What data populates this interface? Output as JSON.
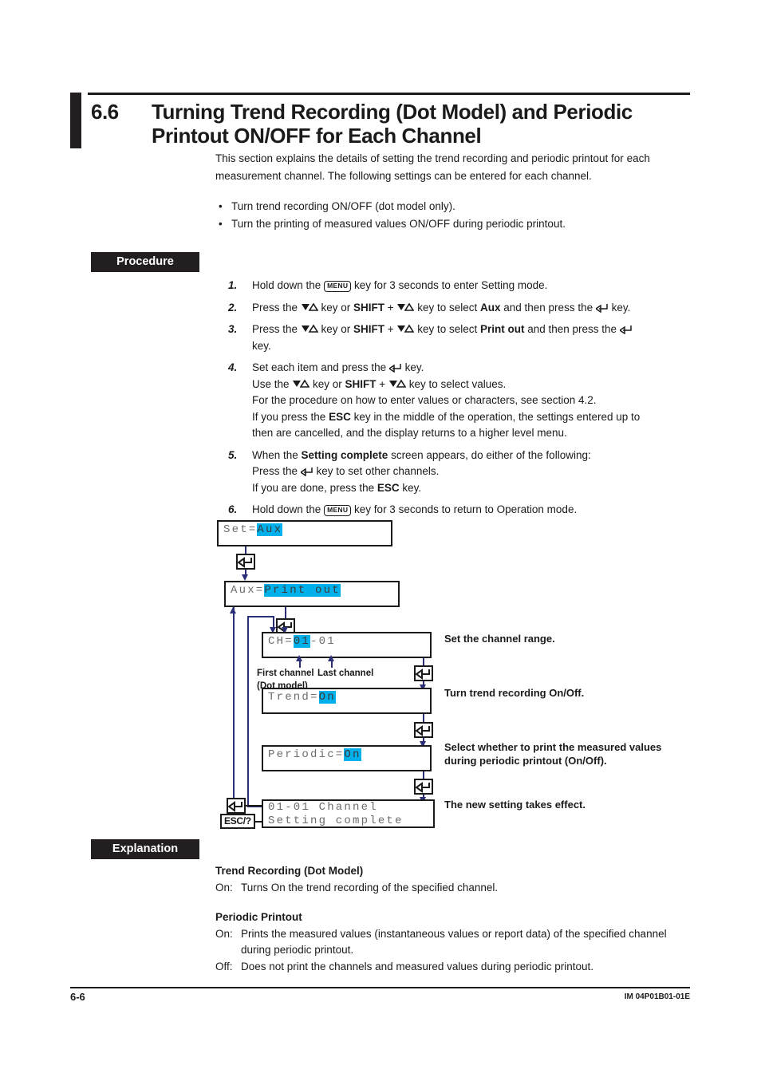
{
  "section": {
    "number": "6.6",
    "title": "Turning Trend Recording (Dot Model) and Periodic Printout ON/OFF for Each Channel",
    "intro_line1": "This section explains the details of setting the trend recording and periodic printout for",
    "intro_line2": "each measurement channel.",
    "intro_line3": "The following settings can be entered for each channel.",
    "bullet1": "Turn trend recording ON/OFF (dot model only).",
    "bullet2": "Turn the printing of measured values ON/OFF during periodic printout."
  },
  "labels": {
    "procedure": "Procedure",
    "explanation": "Explanation"
  },
  "steps": [
    {
      "num": "1.",
      "lines": [
        "Hold down the [MENU] key for 3 seconds to enter Setting mode."
      ]
    },
    {
      "num": "2.",
      "lines": [
        "Press the ▽△ key or SHIFT + ▽△ key to select Aux and then press the ↵ key."
      ]
    },
    {
      "num": "3.",
      "lines": [
        "Press the ▽△ key or SHIFT + ▽△ key to select Print out and then press the ↵",
        "key."
      ]
    },
    {
      "num": "4.",
      "lines": [
        "Set each item and press the ↵ key.",
        "Use the ▽△ key or SHIFT + ▽△ key to select values.",
        "For the procedure on how to enter values or characters, see section 4.2.",
        "If you press the ESC key in the middle of the operation, the settings entered up to",
        "then are cancelled, and the display returns to a higher level menu."
      ]
    },
    {
      "num": "5.",
      "lines": [
        "When the Setting complete screen appears, do either of the following:",
        "Press the ↵ key to set other channels.",
        "If you are done, press the ESC key."
      ]
    },
    {
      "num": "6.",
      "lines": [
        "Hold down the [MENU] key for 3 seconds to return to Operation mode."
      ]
    }
  ],
  "step_text": {
    "s1_a": "Hold down the ",
    "s1_menu": "MENU",
    "s1_b": " key for 3 seconds to enter Setting mode.",
    "s2_a": "Press the ",
    "s2_b": " key or ",
    "s2_shift": "SHIFT",
    "s2_c": " + ",
    "s2_d": " key to select ",
    "s2_aux": "Aux",
    "s2_e": " and then press the ",
    "s2_f": " key.",
    "s3_d": " key to select ",
    "s3_printout": "Print out",
    "s3_e": " and then press the ",
    "s3_f": "key.",
    "s4_l1a": "Set each item and press the ",
    "s4_l1b": " key.",
    "s4_l2a": "Use the ",
    "s4_l2b": " key or ",
    "s4_l2c": " key to select values.",
    "s4_l3": "For the procedure on how to enter values or characters, see section 4.2.",
    "s4_l4a": "If you press the ",
    "s4_esc": "ESC",
    "s4_l4b": " key in the middle of the operation, the settings entered up to",
    "s4_l5": "then are cancelled, and the display returns to a higher level menu.",
    "s5_l1a": "When the ",
    "s5_sc": "Setting complete",
    "s5_l1b": " screen appears, do either of the following:",
    "s5_l2a": "Press the ",
    "s5_l2b": " key to set other channels.",
    "s5_l3a": "If you are done, press the ",
    "s5_l3b": " key.",
    "s6_a": "Hold down the ",
    "s6_menu": "MENU",
    "s6_b": " key for 3 seconds to return to Operation mode."
  },
  "flow": {
    "screens": [
      {
        "id": "set-aux",
        "prefix": "Set=",
        "highlight": "Aux",
        "suffix": ""
      },
      {
        "id": "aux-printout",
        "prefix": "Aux=",
        "highlight": "Print out",
        "suffix": ""
      },
      {
        "id": "ch-range",
        "prefix": "CH=",
        "highlight": "01",
        "suffix": "-01"
      },
      {
        "id": "trend",
        "prefix": "Trend=",
        "highlight": "On",
        "suffix": ""
      },
      {
        "id": "periodic",
        "prefix": "Periodic=",
        "highlight": "On",
        "suffix": ""
      },
      {
        "id": "setting-complete",
        "line1": "01-01 Channel",
        "line2": "Setting complete"
      }
    ],
    "notes": {
      "channel_range": "Set the channel range.",
      "trend": "Turn trend recording On/Off.",
      "periodic_l1": "Select whether to print the measured",
      "periodic_l2": "values during periodic printout (On/Off).",
      "complete": "The new setting takes effect."
    },
    "callouts": {
      "first_channel": "First channel",
      "last_channel": "Last channel",
      "dot_model": "(Dot model)"
    },
    "esc_key": "ESC/?"
  },
  "explanation": {
    "heading1": "Trend Recording (Dot Model)",
    "d1_term": "On:",
    "d1_text": "Turns On the trend recording of the specified channel.",
    "heading2": "Periodic Printout",
    "d2_term": "On:",
    "d2_text_l1": "Prints the measured values (instantaneous values or report data) of the specified",
    "d2_text_l2": "channel during periodic printout.",
    "d3_term": "Off:",
    "d3_text": "Does not print the channels and measured values during periodic printout."
  },
  "footer": {
    "page": "6-6",
    "doc_id": "IM 04P01B01-01E"
  },
  "colors": {
    "highlight": "#00b0eb",
    "line": "#2b2f77",
    "ink": "#231f20"
  }
}
